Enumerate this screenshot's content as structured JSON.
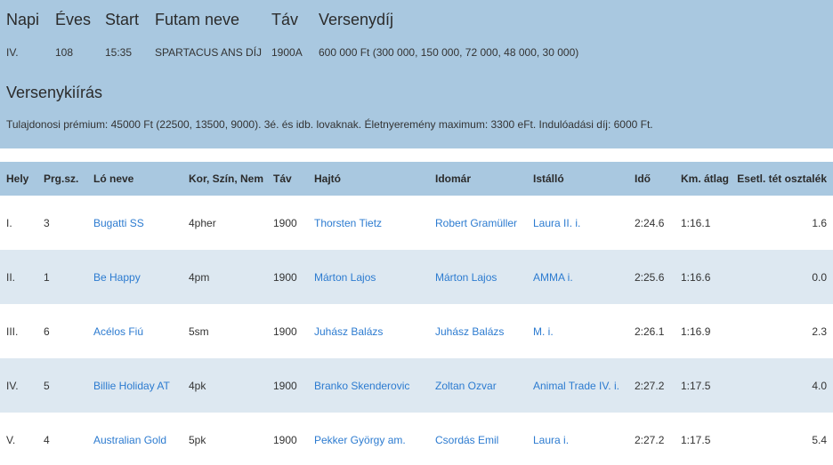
{
  "race": {
    "headers": [
      "Napi",
      "Éves",
      "Start",
      "Futam neve",
      "Táv",
      "Versenydíj"
    ],
    "values": [
      "IV.",
      "108",
      "15:35",
      "SPARTACUS ANS DÍJ",
      "1900A",
      "600 000 Ft (300 000, 150 000, 72 000, 48 000, 30 000)"
    ]
  },
  "conditions": {
    "title": "Versenykiírás",
    "text": "Tulajdonosi prémium: 45000 Ft (22500, 13500, 9000). 3é. és idb. lovaknak. Életnyeremény maximum: 3300 eFt. Indulóadási díj: 6000 Ft."
  },
  "results": {
    "columns": [
      "Hely",
      "Prg.sz.",
      "Ló neve",
      "Kor, Szín, Nem",
      "Táv",
      "Hajtó",
      "Idomár",
      "Istálló",
      "Idő",
      "Km. átlag",
      "Esetl. tét osztalék"
    ],
    "rows": [
      [
        "I.",
        "3",
        "Bugatti SS",
        "4pher",
        "1900",
        "Thorsten Tietz",
        "Robert Gramüller",
        "Laura II. i.",
        "2:24.6",
        "1:16.1",
        "1.6"
      ],
      [
        "II.",
        "1",
        "Be Happy",
        "4pm",
        "1900",
        "Márton Lajos",
        "Márton Lajos",
        "AMMA i.",
        "2:25.6",
        "1:16.6",
        "0.0"
      ],
      [
        "III.",
        "6",
        "Acélos Fiú",
        "5sm",
        "1900",
        "Juhász Balázs",
        "Juhász Balázs",
        "M. i.",
        "2:26.1",
        "1:16.9",
        "2.3"
      ],
      [
        "IV.",
        "5",
        "Billie Holiday AT",
        "4pk",
        "1900",
        "Branko Skenderovic",
        "Zoltan Ozvar",
        "Animal Trade IV. i.",
        "2:27.2",
        "1:17.5",
        "4.0"
      ],
      [
        "V.",
        "4",
        "Australian Gold",
        "5pk",
        "1900",
        "Pekker György am.",
        "Csordás Emil",
        "Laura i.",
        "2:27.2",
        "1:17.5",
        "5.4"
      ]
    ]
  },
  "colors": {
    "header_bg": "#a9c8e0",
    "row_alt_bg": "#dde8f1",
    "link": "#2c7bd0"
  }
}
